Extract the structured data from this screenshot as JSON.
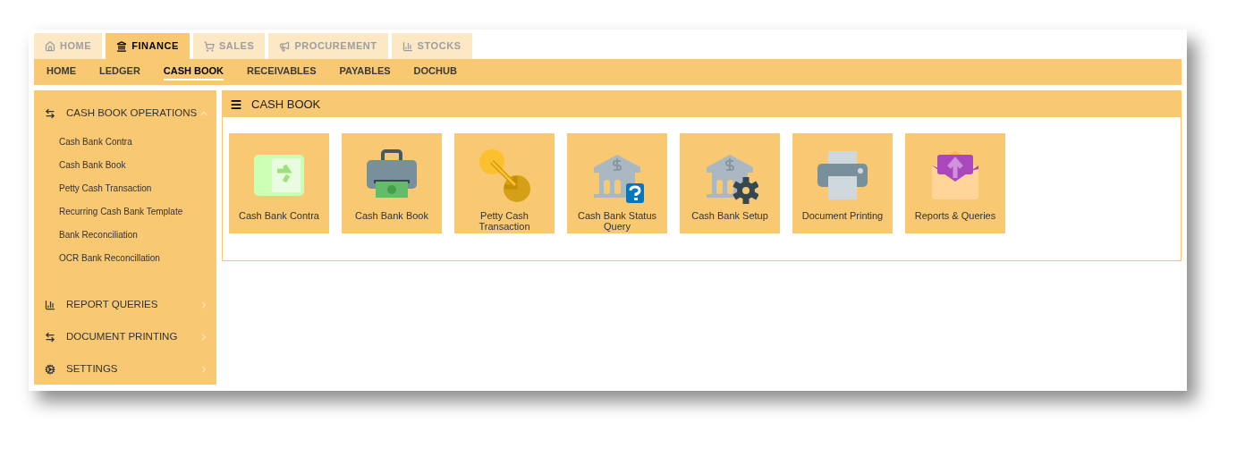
{
  "top_tabs": [
    {
      "label": "HOME",
      "kind": "home",
      "selected": false
    },
    {
      "label": "FINANCE",
      "kind": "bank",
      "selected": true
    },
    {
      "label": "SALES",
      "kind": "cart",
      "selected": false
    },
    {
      "label": "PROCUREMENT",
      "kind": "megaphone",
      "selected": false
    },
    {
      "label": "STOCKS",
      "kind": "chart",
      "selected": false
    }
  ],
  "sub_nav": [
    {
      "label": "HOME",
      "selected": false
    },
    {
      "label": "LEDGER",
      "selected": false
    },
    {
      "label": "CASH BOOK",
      "selected": true
    },
    {
      "label": "RECEIVABLES",
      "selected": false
    },
    {
      "label": "PAYABLES",
      "selected": false
    },
    {
      "label": "DOCHUB",
      "selected": false
    }
  ],
  "sidebar": {
    "sections": [
      {
        "label": "CASH BOOK OPERATIONS",
        "kind": "arrows",
        "expanded": true,
        "children": [
          {
            "label": "Cash Bank Contra"
          },
          {
            "label": "Cash Bank Book"
          },
          {
            "label": "Petty Cash Transaction"
          },
          {
            "label": "Recurring Cash Bank Template"
          },
          {
            "label": "Bank Reconciliation"
          },
          {
            "label": "OCR Bank Reconcillation"
          }
        ]
      },
      {
        "label": "REPORT QUERIES",
        "kind": "chart",
        "expanded": false
      },
      {
        "label": "DOCUMENT PRINTING",
        "kind": "arrows",
        "expanded": false
      },
      {
        "label": "SETTINGS",
        "kind": "cogs",
        "expanded": false
      }
    ]
  },
  "panel": {
    "title": "CASH BOOK",
    "tiles": [
      {
        "label": "Cash Bank Contra",
        "kind": "contra"
      },
      {
        "label": "Cash Bank Book",
        "kind": "book"
      },
      {
        "label": "Petty Cash Transaction",
        "kind": "petty"
      },
      {
        "label": "Cash Bank Status Query",
        "kind": "query"
      },
      {
        "label": "Cash Bank Setup",
        "kind": "setup"
      },
      {
        "label": "Document Printing",
        "kind": "printer"
      },
      {
        "label": "Reports & Queries",
        "kind": "reports"
      }
    ]
  }
}
